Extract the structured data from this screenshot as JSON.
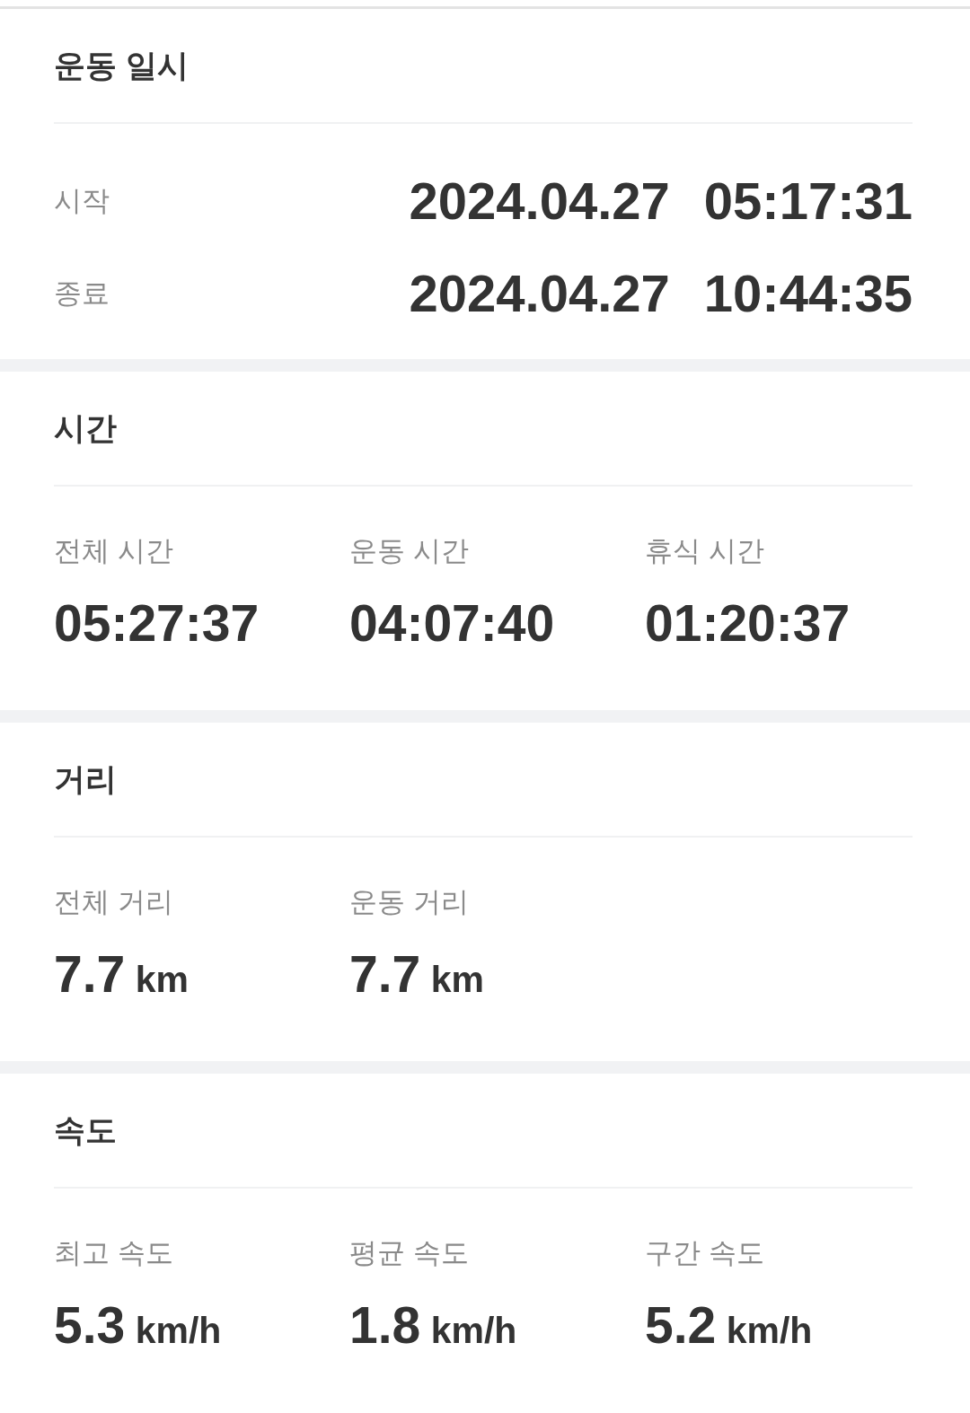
{
  "sections": [
    {
      "kind": "datetime",
      "title": "운동 일시",
      "rows": [
        {
          "label": "시작",
          "date": "2024.04.27",
          "time": "05:17:31"
        },
        {
          "label": "종료",
          "date": "2024.04.27",
          "time": "10:44:35"
        }
      ]
    },
    {
      "kind": "stats",
      "title": "시간",
      "stats": [
        {
          "label": "전체 시간",
          "value": "05:27:37"
        },
        {
          "label": "운동 시간",
          "value": "04:07:40"
        },
        {
          "label": "휴식 시간",
          "value": "01:20:37"
        }
      ]
    },
    {
      "kind": "stats",
      "title": "거리",
      "stats": [
        {
          "label": "전체 거리",
          "value": "7.7",
          "unit": "km"
        },
        {
          "label": "운동 거리",
          "value": "7.7",
          "unit": "km"
        }
      ]
    },
    {
      "kind": "stats",
      "title": "속도",
      "stats": [
        {
          "label": "최고 속도",
          "value": "5.3",
          "unit": "km/h"
        },
        {
          "label": "평균 속도",
          "value": "1.8",
          "unit": "km/h"
        },
        {
          "label": "구간 속도",
          "value": "5.2",
          "unit": "km/h"
        }
      ]
    }
  ]
}
